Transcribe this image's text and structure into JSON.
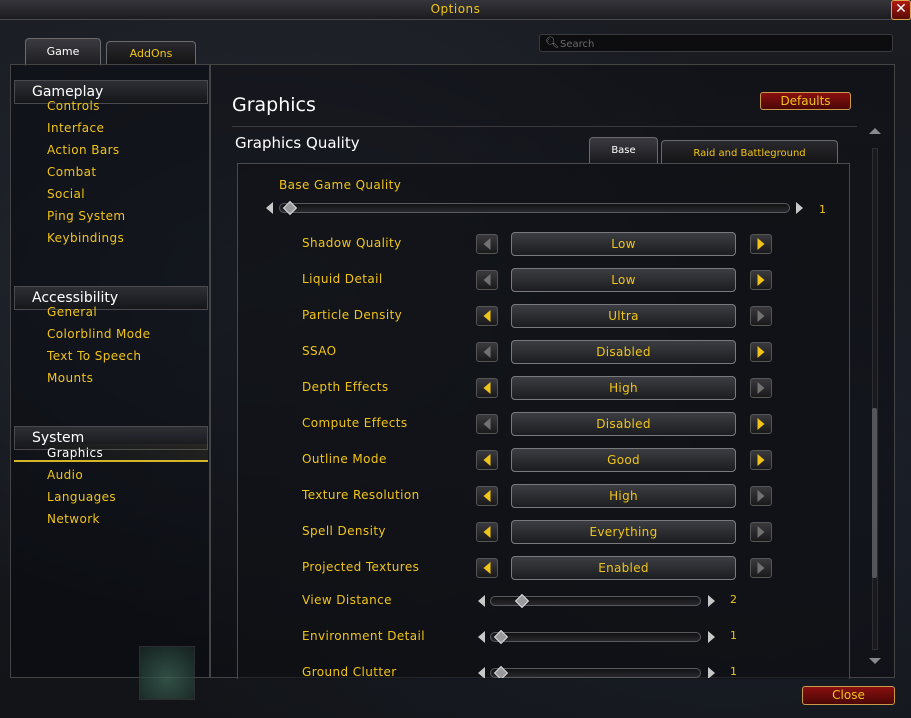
{
  "window": {
    "title": "Options",
    "close_glyph": "✕"
  },
  "top_tabs": [
    {
      "label": "Game",
      "selected": true
    },
    {
      "label": "AddOns",
      "selected": false
    }
  ],
  "search": {
    "placeholder": "Search",
    "value": ""
  },
  "sidebar": {
    "categories": [
      {
        "header": "Gameplay",
        "items": [
          "Controls",
          "Interface",
          "Action Bars",
          "Combat",
          "Social",
          "Ping System",
          "Keybindings"
        ]
      },
      {
        "header": "Accessibility",
        "items": [
          "General",
          "Colorblind Mode",
          "Text To Speech",
          "Mounts"
        ]
      },
      {
        "header": "System",
        "items": [
          "Graphics",
          "Audio",
          "Languages",
          "Network"
        ],
        "selected_item": "Graphics"
      }
    ]
  },
  "main": {
    "title": "Graphics",
    "defaults_label": "Defaults",
    "section_title": "Graphics Quality",
    "quality_tabs": [
      {
        "label": "Base",
        "selected": true
      },
      {
        "label": "Raid and Battleground",
        "selected": false
      }
    ],
    "base_game_quality": {
      "label": "Base Game Quality",
      "value": "1",
      "fraction": 0.0
    },
    "settings": [
      {
        "label": "Shadow Quality",
        "value": "Low",
        "left_enabled": false,
        "right_enabled": true
      },
      {
        "label": "Liquid Detail",
        "value": "Low",
        "left_enabled": false,
        "right_enabled": true
      },
      {
        "label": "Particle Density",
        "value": "Ultra",
        "left_enabled": true,
        "right_enabled": false
      },
      {
        "label": "SSAO",
        "value": "Disabled",
        "left_enabled": false,
        "right_enabled": true
      },
      {
        "label": "Depth Effects",
        "value": "High",
        "left_enabled": true,
        "right_enabled": false
      },
      {
        "label": "Compute Effects",
        "value": "Disabled",
        "left_enabled": false,
        "right_enabled": true
      },
      {
        "label": "Outline Mode",
        "value": "Good",
        "left_enabled": true,
        "right_enabled": true
      },
      {
        "label": "Texture Resolution",
        "value": "High",
        "left_enabled": true,
        "right_enabled": false
      },
      {
        "label": "Spell Density",
        "value": "Everything",
        "left_enabled": true,
        "right_enabled": false
      },
      {
        "label": "Projected Textures",
        "value": "Enabled",
        "left_enabled": true,
        "right_enabled": false
      }
    ],
    "sliders": [
      {
        "label": "View Distance",
        "value": "2",
        "fraction": 0.11
      },
      {
        "label": "Environment Detail",
        "value": "1",
        "fraction": 0.0
      },
      {
        "label": "Ground Clutter",
        "value": "1",
        "fraction": 0.0
      }
    ]
  },
  "footer": {
    "close_label": "Close"
  },
  "colors": {
    "accent_gold": "#f0c419",
    "button_red": "#8a1010",
    "selected_underline": "#d6b42a"
  }
}
